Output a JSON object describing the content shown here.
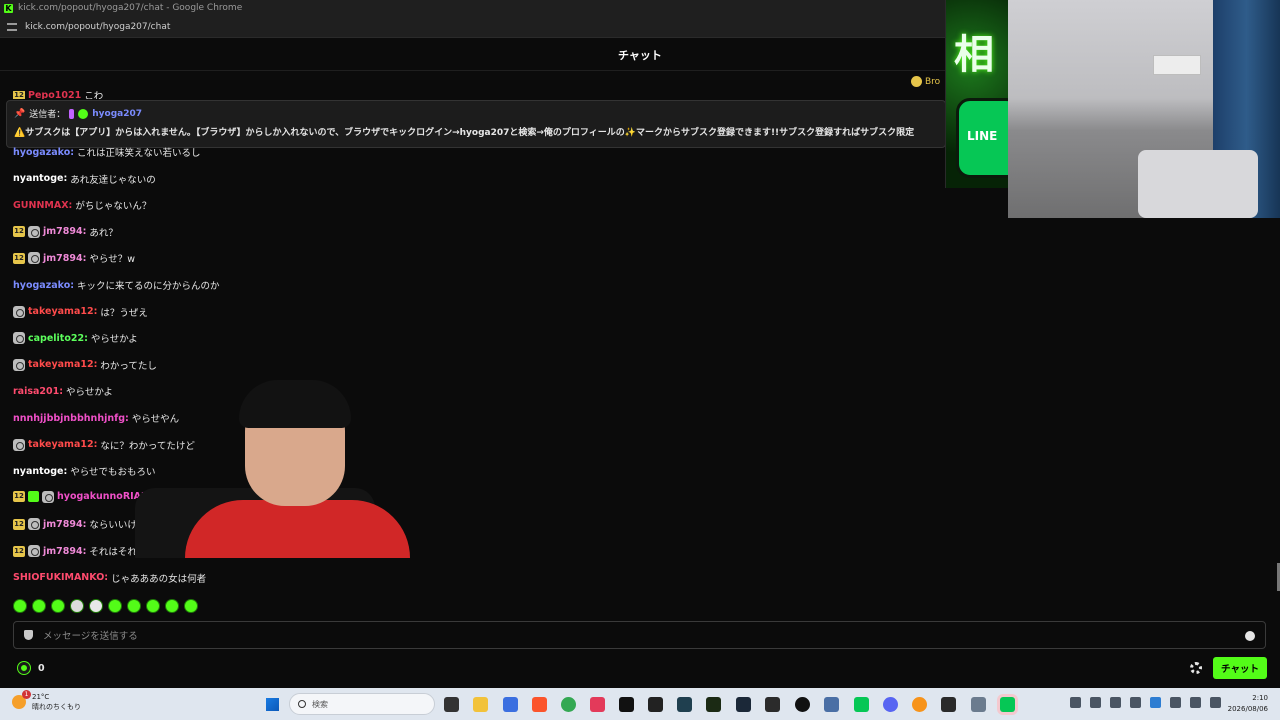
{
  "window": {
    "title": "kick.com/popout/hyoga207/chat - Google Chrome",
    "url": "kick.com/popout/hyoga207/chat"
  },
  "chat": {
    "header": "チャット",
    "top_clipped_user": "Pepo1021",
    "top_clipped_text": "こわ",
    "top_right_partial": "Bro",
    "pinned": {
      "sender_label": "送信者：",
      "sender": "hyoga207",
      "text": "⚠️サブスクは【アプリ】からは入れません。【ブラウザ】からしか入れないので、ブラウザでキックログイン→hyoga207と検索→俺のプロフィールの✨マークからサブスク登録できます!!サブスク登録すればサブスク限定"
    },
    "messages": [
      {
        "badges": [],
        "user": "hyogazako",
        "color": "#7b8cff",
        "text": "これは正味笑えない若いるし"
      },
      {
        "badges": [],
        "user": "nyantoge",
        "color": "#ffffff",
        "text": "あれ友達じゃないの"
      },
      {
        "badges": [],
        "user": "GUNNMAX",
        "color": "#e0334f",
        "text": "がちじゃないん？"
      },
      {
        "badges": [
          "sub",
          "mod"
        ],
        "user": "jm7894",
        "color": "#f08ad8",
        "text": "あれ？"
      },
      {
        "badges": [
          "sub",
          "mod"
        ],
        "user": "jm7894",
        "color": "#f08ad8",
        "text": "やらせ？w"
      },
      {
        "badges": [],
        "user": "hyogazako",
        "color": "#7b8cff",
        "text": "キックに来てるのに分からんのか"
      },
      {
        "badges": [
          "mod"
        ],
        "user": "takeyama12",
        "color": "#ff4b4b",
        "text": "は？うぜえ"
      },
      {
        "badges": [
          "mod"
        ],
        "user": "capelito22",
        "color": "#5cff5c",
        "text": "やらせかよ"
      },
      {
        "badges": [
          "mod"
        ],
        "user": "takeyama12",
        "color": "#ff4b4b",
        "text": "わかってたし"
      },
      {
        "badges": [],
        "user": "raisa201",
        "color": "#ff4b6e",
        "text": "やらせかよ"
      },
      {
        "badges": [],
        "user": "nnnhjjbbjnbbhnhjnfg",
        "color": "#f050c8",
        "text": "やらせやん"
      },
      {
        "badges": [
          "mod"
        ],
        "user": "takeyama12",
        "color": "#ff4b4b",
        "text": "なに？わかってたけど"
      },
      {
        "badges": [],
        "user": "nyantoge",
        "color": "#ffffff",
        "text": "やらせでもおもろい"
      },
      {
        "badges": [
          "sub",
          "gift",
          "mod"
        ],
        "user": "hyogakunnoRIAKO",
        "color": "#f050c8",
        "text": ""
      },
      {
        "badges": [
          "sub",
          "mod"
        ],
        "user": "jm7894",
        "color": "#f08ad8",
        "text": "ならいいけど"
      },
      {
        "badges": [
          "sub",
          "mod"
        ],
        "user": "jm7894",
        "color": "#f08ad8",
        "text": "それはそれで"
      },
      {
        "badges": [],
        "user": "SHIOFUKIMANKO",
        "color": "#ff4b6e",
        "text": "じゃあああの女は何者"
      }
    ],
    "sub_badge_label": "12",
    "input_placeholder": "メッセージを送信する",
    "points": "0",
    "send_label": "チャット"
  },
  "promo": {
    "kanji": "相",
    "line_label": "LINE"
  },
  "taskbar": {
    "weather_temp": "21°C",
    "weather_desc": "晴れのちくもり",
    "search_placeholder": "検索",
    "time": "2:10",
    "date": "2026/08/06"
  }
}
